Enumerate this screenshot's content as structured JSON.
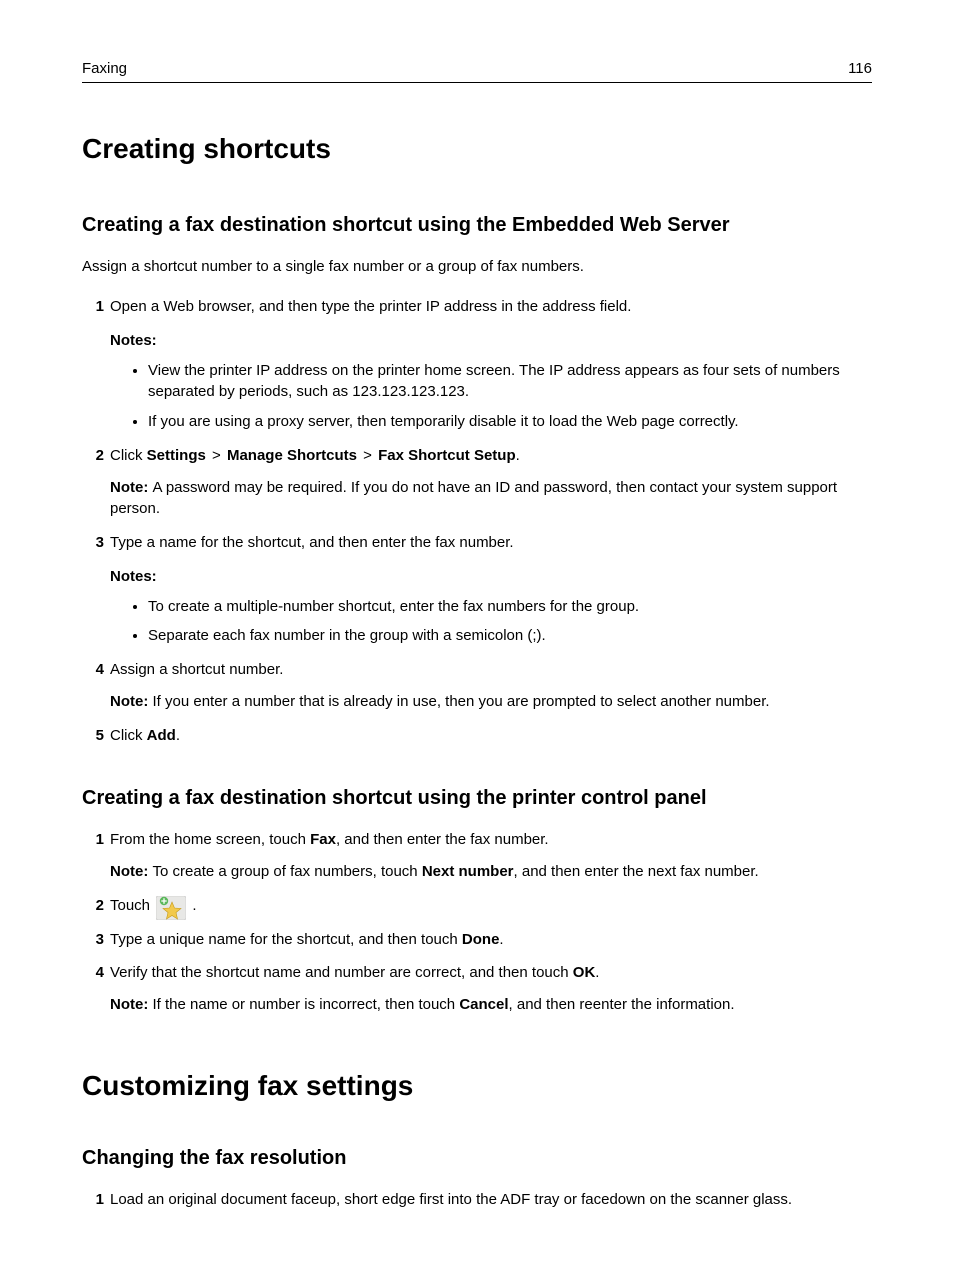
{
  "header": {
    "section": "Faxing",
    "page": "116"
  },
  "h1a": "Creating shortcuts",
  "sec1": {
    "title": "Creating a fax destination shortcut using the Embedded Web Server",
    "intro": "Assign a shortcut number to a single fax number or a group of fax numbers.",
    "step1": "Open a Web browser, and then type the printer IP address in the address field.",
    "notes1_label": "Notes:",
    "notes1_b1": "View the printer IP address on the printer home screen. The IP address appears as four sets of numbers separated by periods, such as 123.123.123.123.",
    "notes1_b2": "If you are using a proxy server, then temporarily disable it to load the Web page correctly.",
    "step2_pre": "Click ",
    "step2_b1": "Settings",
    "step2_sep": " > ",
    "step2_b2": "Manage Shortcuts",
    "step2_b3": "Fax Shortcut Setup",
    "step2_post": ".",
    "step2_note_label": "Note: ",
    "step2_note": "A password may be required. If you do not have an ID and password, then contact your system support person.",
    "step3": "Type a name for the shortcut, and then enter the fax number.",
    "notes3_label": "Notes:",
    "notes3_b1": "To create a multiple-number shortcut, enter the fax numbers for the group.",
    "notes3_b2": "Separate each fax number in the group with a semicolon (;).",
    "step4": "Assign a shortcut number.",
    "step4_note_label": "Note: ",
    "step4_note": "If you enter a number that is already in use, then you are prompted to select another number.",
    "step5_pre": "Click ",
    "step5_b": "Add",
    "step5_post": "."
  },
  "sec2": {
    "title": "Creating a fax destination shortcut using the printer control panel",
    "step1_pre": "From the home screen, touch ",
    "step1_b": "Fax",
    "step1_post": ", and then enter the fax number.",
    "step1_note_label": "Note: ",
    "step1_note_pre": "To create a group of fax numbers, touch ",
    "step1_note_b": "Next number",
    "step1_note_post": ", and then enter the next fax number.",
    "step2_pre": "Touch ",
    "step2_post": ".",
    "step3_pre": "Type a unique name for the shortcut, and then touch ",
    "step3_b": "Done",
    "step3_post": ".",
    "step4_pre": "Verify that the shortcut name and number are correct, and then touch ",
    "step4_b": "OK",
    "step4_post": ".",
    "step4_note_label": "Note: ",
    "step4_note_pre": "If the name or number is incorrect, then touch ",
    "step4_note_b": "Cancel",
    "step4_note_post": ", and then reenter the information."
  },
  "h1b": "Customizing fax settings",
  "sec3": {
    "title": "Changing the fax resolution",
    "step1": "Load an original document faceup, short edge first into the ADF tray or facedown on the scanner glass."
  }
}
